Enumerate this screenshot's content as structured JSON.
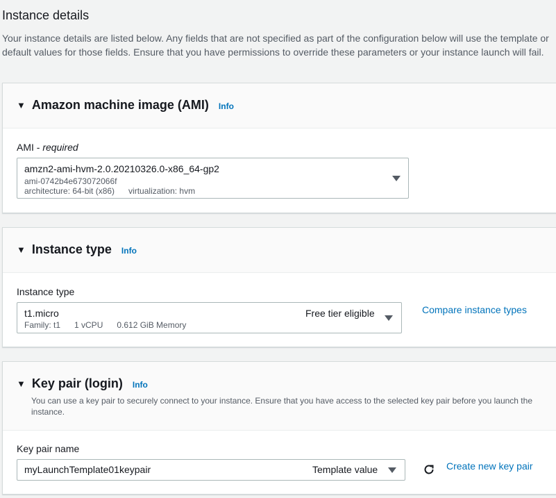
{
  "page": {
    "title": "Instance details",
    "description": "Your instance details are listed below. Any fields that are not specified as part of the configuration below will use the template or default values for those fields. Ensure that you have permissions to override these parameters or your instance launch will fail."
  },
  "ami": {
    "title": "Amazon machine image (AMI)",
    "info": "Info",
    "label": "AMI",
    "label_required": "required",
    "name": "amzn2-ami-hvm-2.0.20210326.0-x86_64-gp2",
    "id": "ami-0742b4e673072066f",
    "meta": "architecture: 64-bit (x86)      virtualization: hvm"
  },
  "instance_type": {
    "title": "Instance type",
    "info": "Info",
    "label": "Instance type",
    "value": "t1.micro",
    "meta": "Family: t1      1 vCPU      0.612 GiB Memory",
    "badge": "Free tier eligible",
    "compare_link": "Compare instance types"
  },
  "key_pair": {
    "title": "Key pair (login)",
    "info": "Info",
    "description": "You can use a key pair to securely connect to your instance. Ensure that you have access to the selected key pair before you launch the instance.",
    "label": "Key pair name",
    "value": "myLaunchTemplate01keypair",
    "source": "Template value",
    "create_link": "Create new key pair"
  },
  "colors": {
    "link": "#0073bb",
    "border": "#aab7b8",
    "background": "#f2f3f3"
  }
}
